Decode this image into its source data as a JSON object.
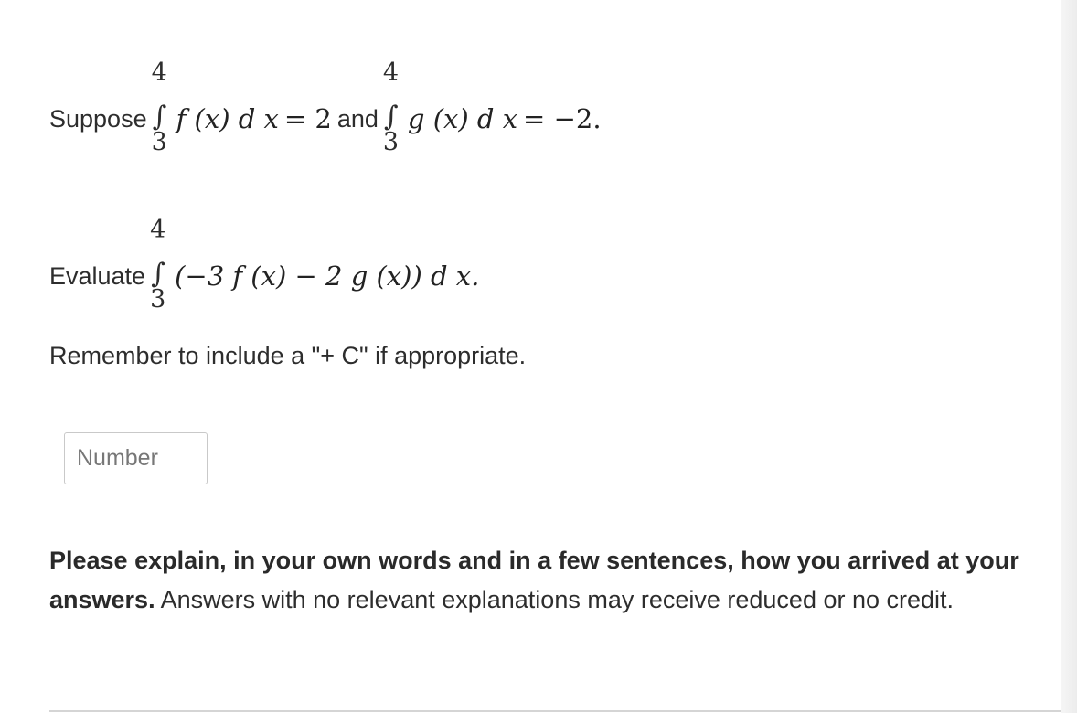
{
  "question": {
    "suppose_label": "Suppose",
    "and_label": "and",
    "integral1": {
      "upper": "4",
      "lower": "3",
      "integrand": "f (x) d x",
      "result": "= 2"
    },
    "integral2": {
      "upper": "4",
      "lower": "3",
      "integrand": "g (x) d x",
      "result": "= −2."
    },
    "evaluate_label": "Evaluate",
    "integral3": {
      "upper": "4",
      "lower": "3",
      "integrand": "(−3 f (x) − 2 g (x)) d x."
    },
    "reminder": "Remember to include a \"+ C\" if appropriate."
  },
  "answer": {
    "placeholder": "Number",
    "value": ""
  },
  "explanation": {
    "bold_text": "Please explain, in your own words and in a few sentences, how you arrived at your answers.",
    "normal_text": " Answers with no relevant explanations may receive reduced or no credit."
  }
}
